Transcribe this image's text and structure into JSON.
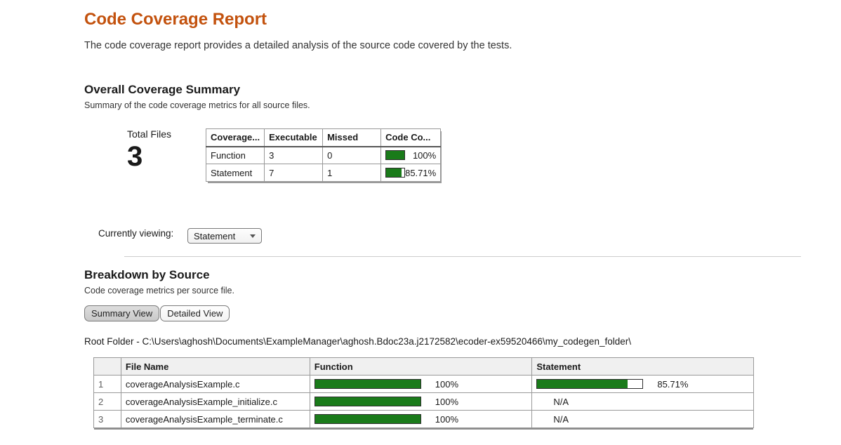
{
  "page": {
    "title": "Code Coverage Report",
    "subtitle": "The code coverage report provides a detailed analysis of the source code covered by the tests."
  },
  "colors": {
    "accent_orange": "#c3520e",
    "bar_green": "#1a7b1a",
    "table_header_bg": "#f0f0f0"
  },
  "overall": {
    "heading": "Overall Coverage Summary",
    "description": "Summary of the code coverage metrics for all source files.",
    "total_files_label": "Total Files",
    "total_files_value": "3",
    "table": {
      "headers": [
        "Coverage...",
        "Executable",
        "Missed",
        "Code Co..."
      ],
      "rows": [
        {
          "type": "Function",
          "executable": "3",
          "missed": "0",
          "percent": 100,
          "percent_label": "100%"
        },
        {
          "type": "Statement",
          "executable": "7",
          "missed": "1",
          "percent": 85.71,
          "percent_label": "85.71%"
        }
      ]
    }
  },
  "currently_viewing": {
    "label": "Currently viewing:",
    "selected": "Statement",
    "chevron_icon": "chevron-down"
  },
  "breakdown": {
    "heading": "Breakdown by Source",
    "description": "Code coverage metrics per source file.",
    "view_buttons": [
      {
        "label": "Summary View",
        "selected": true
      },
      {
        "label": "Detailed View",
        "selected": false
      }
    ],
    "root_folder": "Root Folder - C:\\Users\\aghosh\\Documents\\ExampleManager\\aghosh.Bdoc23a.j2172582\\ecoder-ex59520466\\my_codegen_folder\\",
    "table": {
      "headers": [
        "",
        "File Name",
        "Function",
        "Statement"
      ],
      "rows": [
        {
          "num": "1",
          "file": "coverageAnalysisExample.c",
          "function_percent": 100,
          "function_label": "100%",
          "statement_percent": 85.71,
          "statement_label": "85.71%"
        },
        {
          "num": "2",
          "file": "coverageAnalysisExample_initialize.c",
          "function_percent": 100,
          "function_label": "100%",
          "statement_label": "N/A"
        },
        {
          "num": "3",
          "file": "coverageAnalysisExample_terminate.c",
          "function_percent": 100,
          "function_label": "100%",
          "statement_label": "N/A"
        }
      ]
    }
  }
}
